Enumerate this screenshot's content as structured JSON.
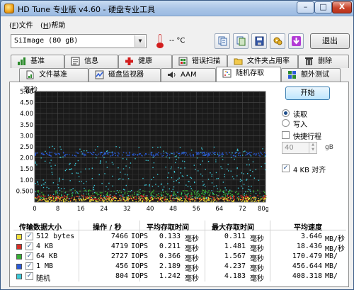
{
  "window": {
    "title": "HD Tune 专业版 v4.60 - 硬盘专业工具",
    "controls": {
      "minimize": "–",
      "maximize": "□",
      "close": "X"
    }
  },
  "menu": {
    "file": "文件",
    "file_key": "F",
    "help": "帮助",
    "help_key": "H"
  },
  "toolbar": {
    "drive": "SiImage  (80 gB)",
    "temperature": "-- °C",
    "exit_label": "退出",
    "icons": [
      "copy-info-icon",
      "copy-screen-icon",
      "save-icon",
      "options-icon",
      "download-icon"
    ]
  },
  "tabs": {
    "row1": [
      {
        "label": "基准",
        "icon": "benchmark-icon"
      },
      {
        "label": "信息",
        "icon": "info-icon"
      },
      {
        "label": "健康",
        "icon": "health-icon"
      },
      {
        "label": "错误扫描",
        "icon": "error-scan-icon"
      },
      {
        "label": "文件夹占用率",
        "icon": "folder-usage-icon"
      },
      {
        "label": "删除",
        "icon": "erase-icon"
      }
    ],
    "row2": [
      {
        "label": "文件基准",
        "icon": "file-benchmark-icon"
      },
      {
        "label": "磁盘监视器",
        "icon": "disk-monitor-icon"
      },
      {
        "label": "AAM",
        "icon": "aam-icon"
      },
      {
        "label": "随机存取",
        "icon": "random-access-icon",
        "active": true
      },
      {
        "label": "额外测试",
        "icon": "extra-tests-icon"
      }
    ]
  },
  "controls": {
    "start_label": "开始",
    "read_label": "读取",
    "write_label": "写入",
    "read_selected": true,
    "short_stroke_label": "快捷行程",
    "short_stroke_checked": false,
    "short_stroke_value": "40",
    "short_stroke_unit": "gB",
    "align_label": "4 KB 对齐",
    "align_checked": true
  },
  "chart_data": {
    "type": "scatter",
    "title": "",
    "ylabel": "毫秒",
    "xlabel": "",
    "x_ticks": [
      "0",
      "8",
      "16",
      "24",
      "32",
      "40",
      "48",
      "56",
      "64",
      "72",
      "80gB"
    ],
    "y_ticks": [
      "5.00",
      "4.50",
      "4.00",
      "3.50",
      "3.00",
      "2.50",
      "2.00",
      "1.50",
      "1.00",
      "0.500"
    ],
    "xlim": [
      0,
      80
    ],
    "ylim": [
      0,
      5
    ],
    "background": "#1a1a1a",
    "grid": true,
    "series": [
      {
        "name": "512 bytes",
        "color": "#f2e03a",
        "center_ms": 0.13,
        "spread_ms": 0.1
      },
      {
        "name": "4 KB",
        "color": "#d93026",
        "center_ms": 0.21,
        "spread_ms": 0.12
      },
      {
        "name": "64 KB",
        "color": "#38b034",
        "center_ms": 0.37,
        "spread_ms": 0.2
      },
      {
        "name": "1 MB",
        "color": "#2a5bd8",
        "center_ms": 2.19,
        "spread_ms": 0.05
      },
      {
        "name": "随机",
        "color": "#3cc8d8",
        "center_ms": 1.24,
        "spread_ms": 1.4
      }
    ]
  },
  "results": {
    "headers": [
      "传输数据大小",
      "操作 / 秒",
      "平均存取时间",
      "最大存取时间",
      "平均速度"
    ],
    "rows": [
      {
        "label": "512 bytes",
        "color": "#f2e03a",
        "ops": "7466",
        "ops_unit": "IOPS",
        "avg": "0.133",
        "avg_unit": "毫秒",
        "max": "0.311",
        "max_unit": "毫秒",
        "speed": "3.646",
        "speed_unit": "MB/秒"
      },
      {
        "label": "4 KB",
        "color": "#d93026",
        "ops": "4719",
        "ops_unit": "IOPS",
        "avg": "0.211",
        "avg_unit": "毫秒",
        "max": "1.481",
        "max_unit": "毫秒",
        "speed": "18.436",
        "speed_unit": "MB/秒"
      },
      {
        "label": "64 KB",
        "color": "#38b034",
        "ops": "2727",
        "ops_unit": "IOPS",
        "avg": "0.366",
        "avg_unit": "毫秒",
        "max": "1.567",
        "max_unit": "毫秒",
        "speed": "170.479",
        "speed_unit": "MB/"
      },
      {
        "label": "1 MB",
        "color": "#2a5bd8",
        "ops": "456",
        "ops_unit": "IOPS",
        "avg": "2.189",
        "avg_unit": "毫秒",
        "max": "4.237",
        "max_unit": "毫秒",
        "speed": "456.644",
        "speed_unit": "MB/"
      },
      {
        "label": "随机",
        "color": "#3cc8d8",
        "ops": "804",
        "ops_unit": "IOPS",
        "avg": "1.242",
        "avg_unit": "毫秒",
        "max": "4.183",
        "max_unit": "毫秒",
        "speed": "408.318",
        "speed_unit": "MB/"
      }
    ]
  }
}
